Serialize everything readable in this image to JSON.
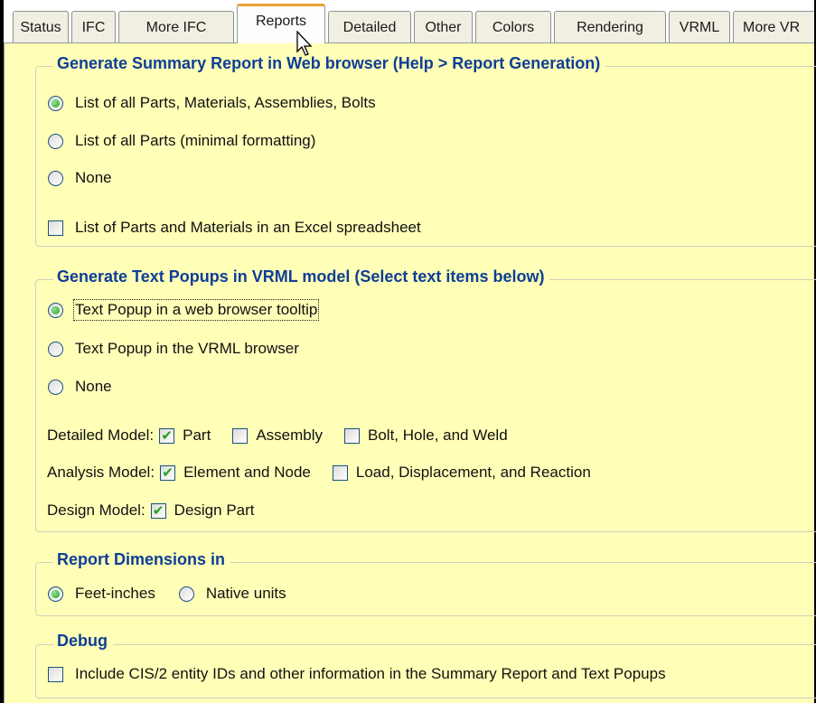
{
  "tabs": [
    "Status",
    "IFC",
    "More IFC",
    "Reports",
    "Detailed",
    "Other",
    "Colors",
    "Rendering",
    "VRML",
    "More VR"
  ],
  "active_tab": "Reports",
  "summary": {
    "title": "Generate Summary Report in Web browser  (Help > Report Generation)",
    "options": [
      "List of all Parts, Materials, Assemblies, Bolts",
      "List of all Parts (minimal formatting)",
      "None"
    ],
    "selected": 0,
    "excel_label": "List of Parts and Materials in an Excel spreadsheet",
    "excel_checked": false
  },
  "popups": {
    "title": "Generate Text Popups in VRML model  (Select text items below)",
    "options": [
      "Text Popup in a web browser tooltip",
      "Text Popup in the VRML browser",
      "None"
    ],
    "selected": 0,
    "detailed": {
      "caption": "Detailed Model:",
      "items": [
        {
          "label": "Part",
          "checked": true
        },
        {
          "label": "Assembly",
          "checked": false
        },
        {
          "label": "Bolt, Hole, and Weld",
          "checked": false
        }
      ]
    },
    "analysis": {
      "caption": "Analysis Model:",
      "items": [
        {
          "label": "Element and Node",
          "checked": true
        },
        {
          "label": "Load, Displacement, and Reaction",
          "checked": false
        }
      ]
    },
    "design": {
      "caption": "Design Model:",
      "items": [
        {
          "label": "Design Part",
          "checked": true
        }
      ]
    }
  },
  "dimensions": {
    "title": "Report Dimensions in",
    "options": [
      "Feet-inches",
      "Native units"
    ],
    "selected": 0
  },
  "debug": {
    "title": "Debug",
    "label": "Include CIS/2 entity IDs and other information in the Summary Report and Text Popups",
    "checked": false
  },
  "colors": {
    "panel": "#ffffb8",
    "group_title": "#0e3e96",
    "active_tab_accent": "#e8a33a",
    "check": "#21a121"
  }
}
